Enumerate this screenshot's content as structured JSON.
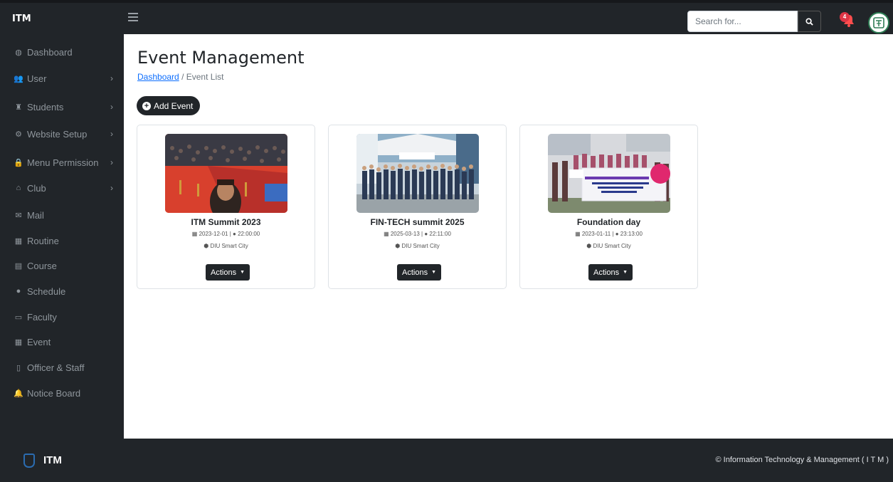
{
  "app": {
    "brand": "ITM"
  },
  "search": {
    "placeholder": "Search for..."
  },
  "notifications": {
    "count": "4"
  },
  "sidebar": {
    "items": [
      {
        "label": "Dashboard",
        "icon": "dashboard-icon",
        "glyph": "◍",
        "has_submenu": false
      },
      {
        "label": "User",
        "icon": "user-icon",
        "glyph": "👥",
        "has_submenu": true
      },
      {
        "label": "Students",
        "icon": "students-icon",
        "glyph": "♜",
        "has_submenu": true
      },
      {
        "label": "Website Setup",
        "icon": "cogs-icon",
        "glyph": "⚙",
        "has_submenu": true
      },
      {
        "label": "Menu Permission",
        "icon": "lock-icon",
        "glyph": "🔒",
        "has_submenu": true
      },
      {
        "label": "Club",
        "icon": "home-icon",
        "glyph": "⌂",
        "has_submenu": true
      },
      {
        "label": "Mail",
        "icon": "mail-icon",
        "glyph": "✉",
        "has_submenu": false
      },
      {
        "label": "Routine",
        "icon": "calendar-icon",
        "glyph": "▦",
        "has_submenu": false
      },
      {
        "label": "Course",
        "icon": "course-icon",
        "glyph": "▤",
        "has_submenu": false
      },
      {
        "label": "Schedule",
        "icon": "clock-icon",
        "glyph": "●",
        "has_submenu": false
      },
      {
        "label": "Faculty",
        "icon": "faculty-icon",
        "glyph": "▭",
        "has_submenu": false
      },
      {
        "label": "Event",
        "icon": "event-icon",
        "glyph": "▦",
        "has_submenu": false
      },
      {
        "label": "Officer & Staff",
        "icon": "staff-icon",
        "glyph": "▯",
        "has_submenu": false
      },
      {
        "label": "Notice Board",
        "icon": "bell-icon",
        "glyph": "🔔",
        "has_submenu": false
      }
    ]
  },
  "main": {
    "title": "Event Management",
    "breadcrumb": {
      "link": "Dashboard",
      "separator": "/",
      "current": "Event List"
    },
    "add_button": "Add Event",
    "events": [
      {
        "title": "ITM Summit 2023",
        "date": "2023-12-01",
        "time": "22:00:00",
        "location": "DIU Smart City",
        "actions_label": "Actions"
      },
      {
        "title": "FIN-TECH summit 2025",
        "date": "2025-03-13",
        "time": "22:11:00",
        "location": "DIU Smart City",
        "actions_label": "Actions"
      },
      {
        "title": "Foundation day",
        "date": "2023-01-11",
        "time": "23:13:00",
        "location": "DIU Smart City",
        "actions_label": "Actions"
      }
    ]
  },
  "footer": {
    "brand": "ITM",
    "copyright": "© Information Technology & Management ( I T M )"
  },
  "colors": {
    "dark": "#212529",
    "link": "#0d6efd",
    "badge": "#dc3545",
    "logo_green": "#2f7d55"
  }
}
